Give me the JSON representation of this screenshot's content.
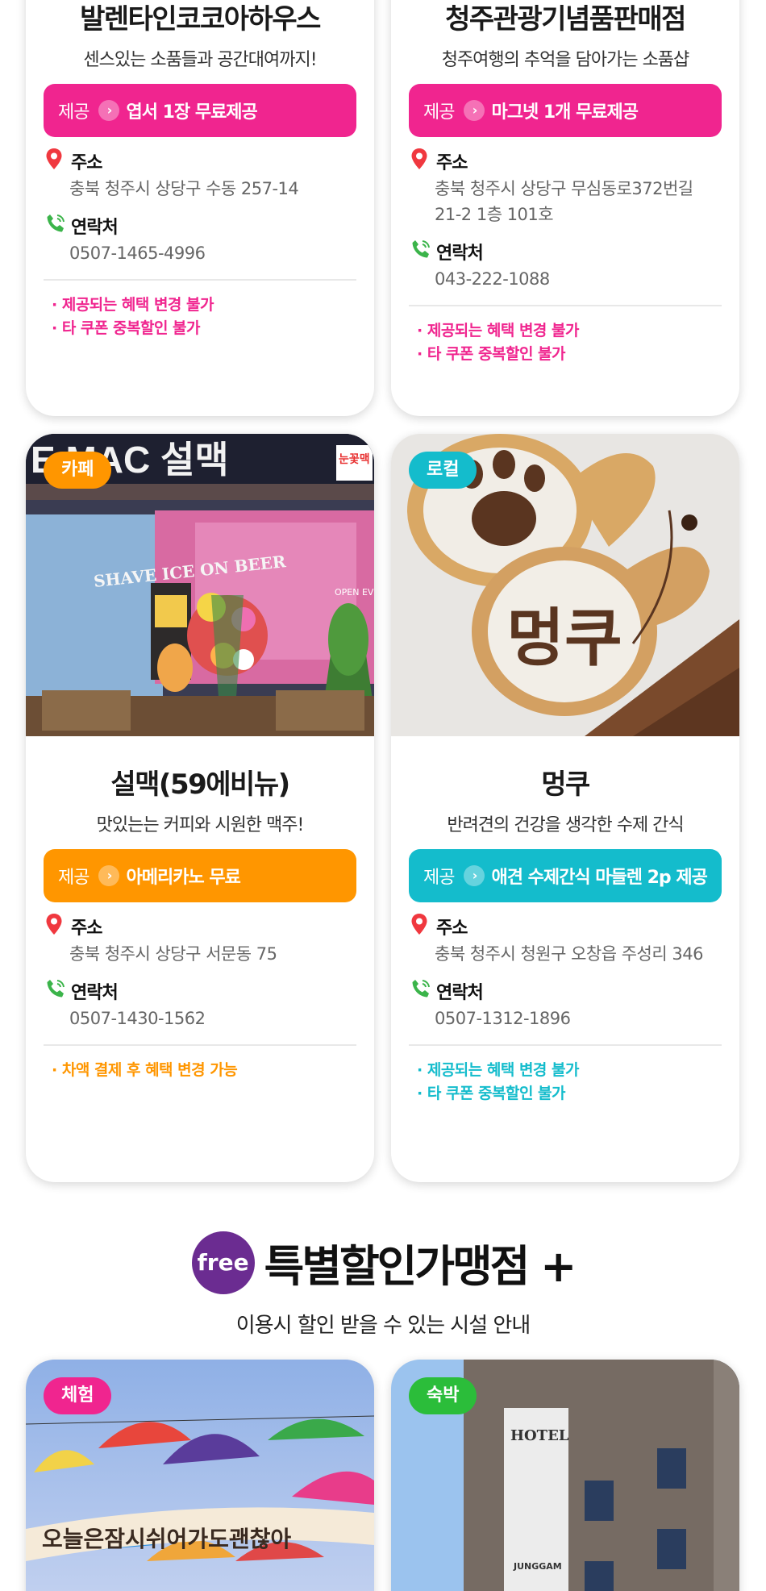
{
  "colors": {
    "pink": "#f0258f",
    "orange": "#ff9600",
    "teal": "#14bccc",
    "green": "#2bbd3a",
    "purple": "#6b2c91",
    "pin_red": "#f0383f",
    "phone_green": "#3bb44a"
  },
  "cards_top": [
    {
      "title": "발렌타인코코아하우스",
      "subtitle": "센스있는 소품들과 공간대여까지!",
      "offer_label": "제공",
      "offer_text": "엽서 1장 무료제공",
      "address_label": "주소",
      "address": "충북 청주시 상당구 수동 257-14",
      "phone_label": "연락처",
      "phone": "0507-1465-4996",
      "notes": [
        "· 제공되는 혜택 변경 불가",
        "· 타 쿠폰 중복할인 불가"
      ]
    },
    {
      "title": "청주관광기념품판매점",
      "subtitle": "청주여행의 추억을 담아가는 소품샵",
      "offer_label": "제공",
      "offer_text": "마그넷 1개 무료제공",
      "address_label": "주소",
      "address": "충북 청주시 상당구 무심동로372번길 21-2 1층 101호",
      "phone_label": "연락처",
      "phone": "043-222-1088",
      "notes": [
        "· 제공되는 혜택 변경 불가",
        "· 타 쿠폰 중복할인 불가"
      ]
    }
  ],
  "cards_mid": [
    {
      "category": "카페",
      "sign_text": "E MAC 설맥",
      "side_sign": "눈꽃맥",
      "window_text": "SHAVE ICE ON BEER",
      "event_text": "OPEN EVENT",
      "title": "설맥(59에비뉴)",
      "subtitle": "맛있는는 커피와 시원한 맥주!",
      "offer_label": "제공",
      "offer_text": "아메리카노 무료",
      "address_label": "주소",
      "address": "충북 청주시 상당구 서문동 75",
      "phone_label": "연락처",
      "phone": "0507-1430-1562",
      "notes": [
        "· 차액 결제 후 혜택 변경 가능"
      ]
    },
    {
      "category": "로컬",
      "cup_text": "멍쿠",
      "title": "멍쿠",
      "subtitle": "반려견의 건강을 생각한 수제 간식",
      "offer_label": "제공",
      "offer_text": "애견 수제간식 마들렌 2p 제공",
      "address_label": "주소",
      "address": "충북 청주시 청원구 오창읍 주성리 346",
      "phone_label": "연락처",
      "phone": "0507-1312-1896",
      "notes": [
        "· 제공되는 혜택 변경 불가",
        "· 타 쿠폰 중복할인 불가"
      ]
    }
  ],
  "section": {
    "badge": "free",
    "title": "특별할인가맹점 +",
    "subtitle": "이용시 할인 받을 수 있는 시설 안내"
  },
  "cards_bottom": [
    {
      "category": "체험",
      "banner_text": "오늘은잠시쉬어가도괜찮아"
    },
    {
      "category": "숙박",
      "hotel_sign": "HOTEL",
      "hotel_name": "JUNGGAM"
    }
  ]
}
